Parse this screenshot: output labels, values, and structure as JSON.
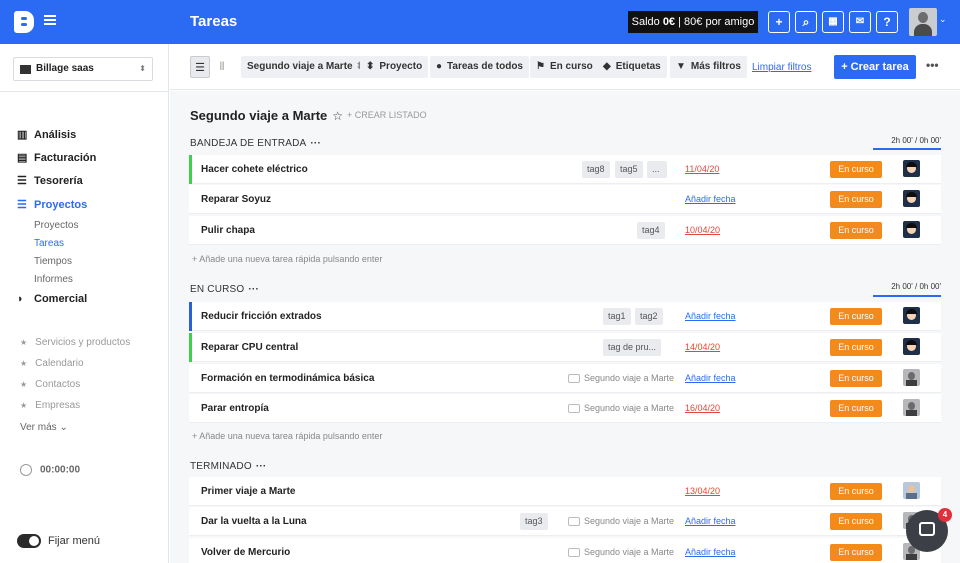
{
  "header": {
    "title": "Tareas",
    "saldo_label": "Saldo",
    "saldo_amount": "0€",
    "saldo_promo": "| 80€ por amigo"
  },
  "sidebar": {
    "company": "Billage saas",
    "nav": [
      {
        "label": "Análisis",
        "icon": "chart-icon"
      },
      {
        "label": "Facturación",
        "icon": "document-icon"
      },
      {
        "label": "Tesorería",
        "icon": "database-icon"
      },
      {
        "label": "Proyectos",
        "icon": "list-icon",
        "active": true
      },
      {
        "label": "Comercial",
        "icon": "handshake-icon"
      }
    ],
    "subnav": [
      "Proyectos",
      "Tareas",
      "Tiempos",
      "Informes"
    ],
    "favorites": [
      "Servicios y productos",
      "Calendario",
      "Contactos",
      "Empresas"
    ],
    "ver_mas": "Ver más",
    "timer": "00:00:00",
    "fijar": "Fijar menú"
  },
  "toolbar": {
    "filters": [
      "Segundo viaje a Marte",
      "Proyecto",
      "Tareas de todos",
      "En curso",
      "Etiquetas",
      "Más filtros"
    ],
    "clear": "Limpiar filtros",
    "create": "+ Crear tarea"
  },
  "list": {
    "title": "Segundo viaje a Marte",
    "create_list": "+ CREAR LISTADO",
    "quick_add": "+ Añade una nueva tarea rápida pulsando enter",
    "sections": [
      {
        "title": "BANDEJA DE ENTRADA",
        "time": "2h 00' / 0h 00'",
        "tasks": [
          {
            "name": "Hacer cohete eléctrico",
            "tags": [
              "tag8",
              "tag5",
              "..."
            ],
            "project": "",
            "date": "11/04/20",
            "status": "En curso"
          },
          {
            "name": "Reparar Soyuz",
            "tags": [],
            "project": "",
            "date": "Añadir fecha",
            "status": "En curso"
          },
          {
            "name": "Pulir chapa",
            "tags": [
              "tag4"
            ],
            "project": "",
            "date": "10/04/20",
            "status": "En curso"
          }
        ]
      },
      {
        "title": "EN CURSO",
        "time": "2h 00' / 0h 00'",
        "tasks": [
          {
            "name": "Reducir fricción extrados",
            "tags": [
              "tag1",
              "tag2"
            ],
            "project": "",
            "date": "Añadir fecha",
            "status": "En curso"
          },
          {
            "name": "Reparar CPU central",
            "tags": [
              "tag de pru..."
            ],
            "project": "",
            "date": "14/04/20",
            "status": "En curso"
          },
          {
            "name": "Formación en termodinámica básica",
            "tags": [],
            "project": "Segundo viaje a Marte",
            "date": "Añadir fecha",
            "status": "En curso"
          },
          {
            "name": "Parar entropía",
            "tags": [],
            "project": "Segundo viaje a Marte",
            "date": "16/04/20",
            "status": "En curso"
          }
        ]
      },
      {
        "title": "TERMINADO",
        "time": "",
        "tasks": [
          {
            "name": "Primer viaje a Marte",
            "tags": [],
            "project": "",
            "date": "13/04/20",
            "status": "En curso"
          },
          {
            "name": "Dar la vuelta a la Luna",
            "tags": [
              "tag3"
            ],
            "project": "Segundo viaje a Marte",
            "date": "Añadir fecha",
            "status": "En curso"
          },
          {
            "name": "Volver de Mercurio",
            "tags": [],
            "project": "Segundo viaje a Marte",
            "date": "Añadir fecha",
            "status": "En curso"
          }
        ]
      }
    ]
  },
  "chat": {
    "badge": "4"
  },
  "colors": {
    "primary": "#2b6bf3",
    "status_orange": "#f28b1c",
    "overdue_red": "#e0463a",
    "bar_green": "#3ecf4f",
    "bar_blue": "#2b5fd9"
  }
}
